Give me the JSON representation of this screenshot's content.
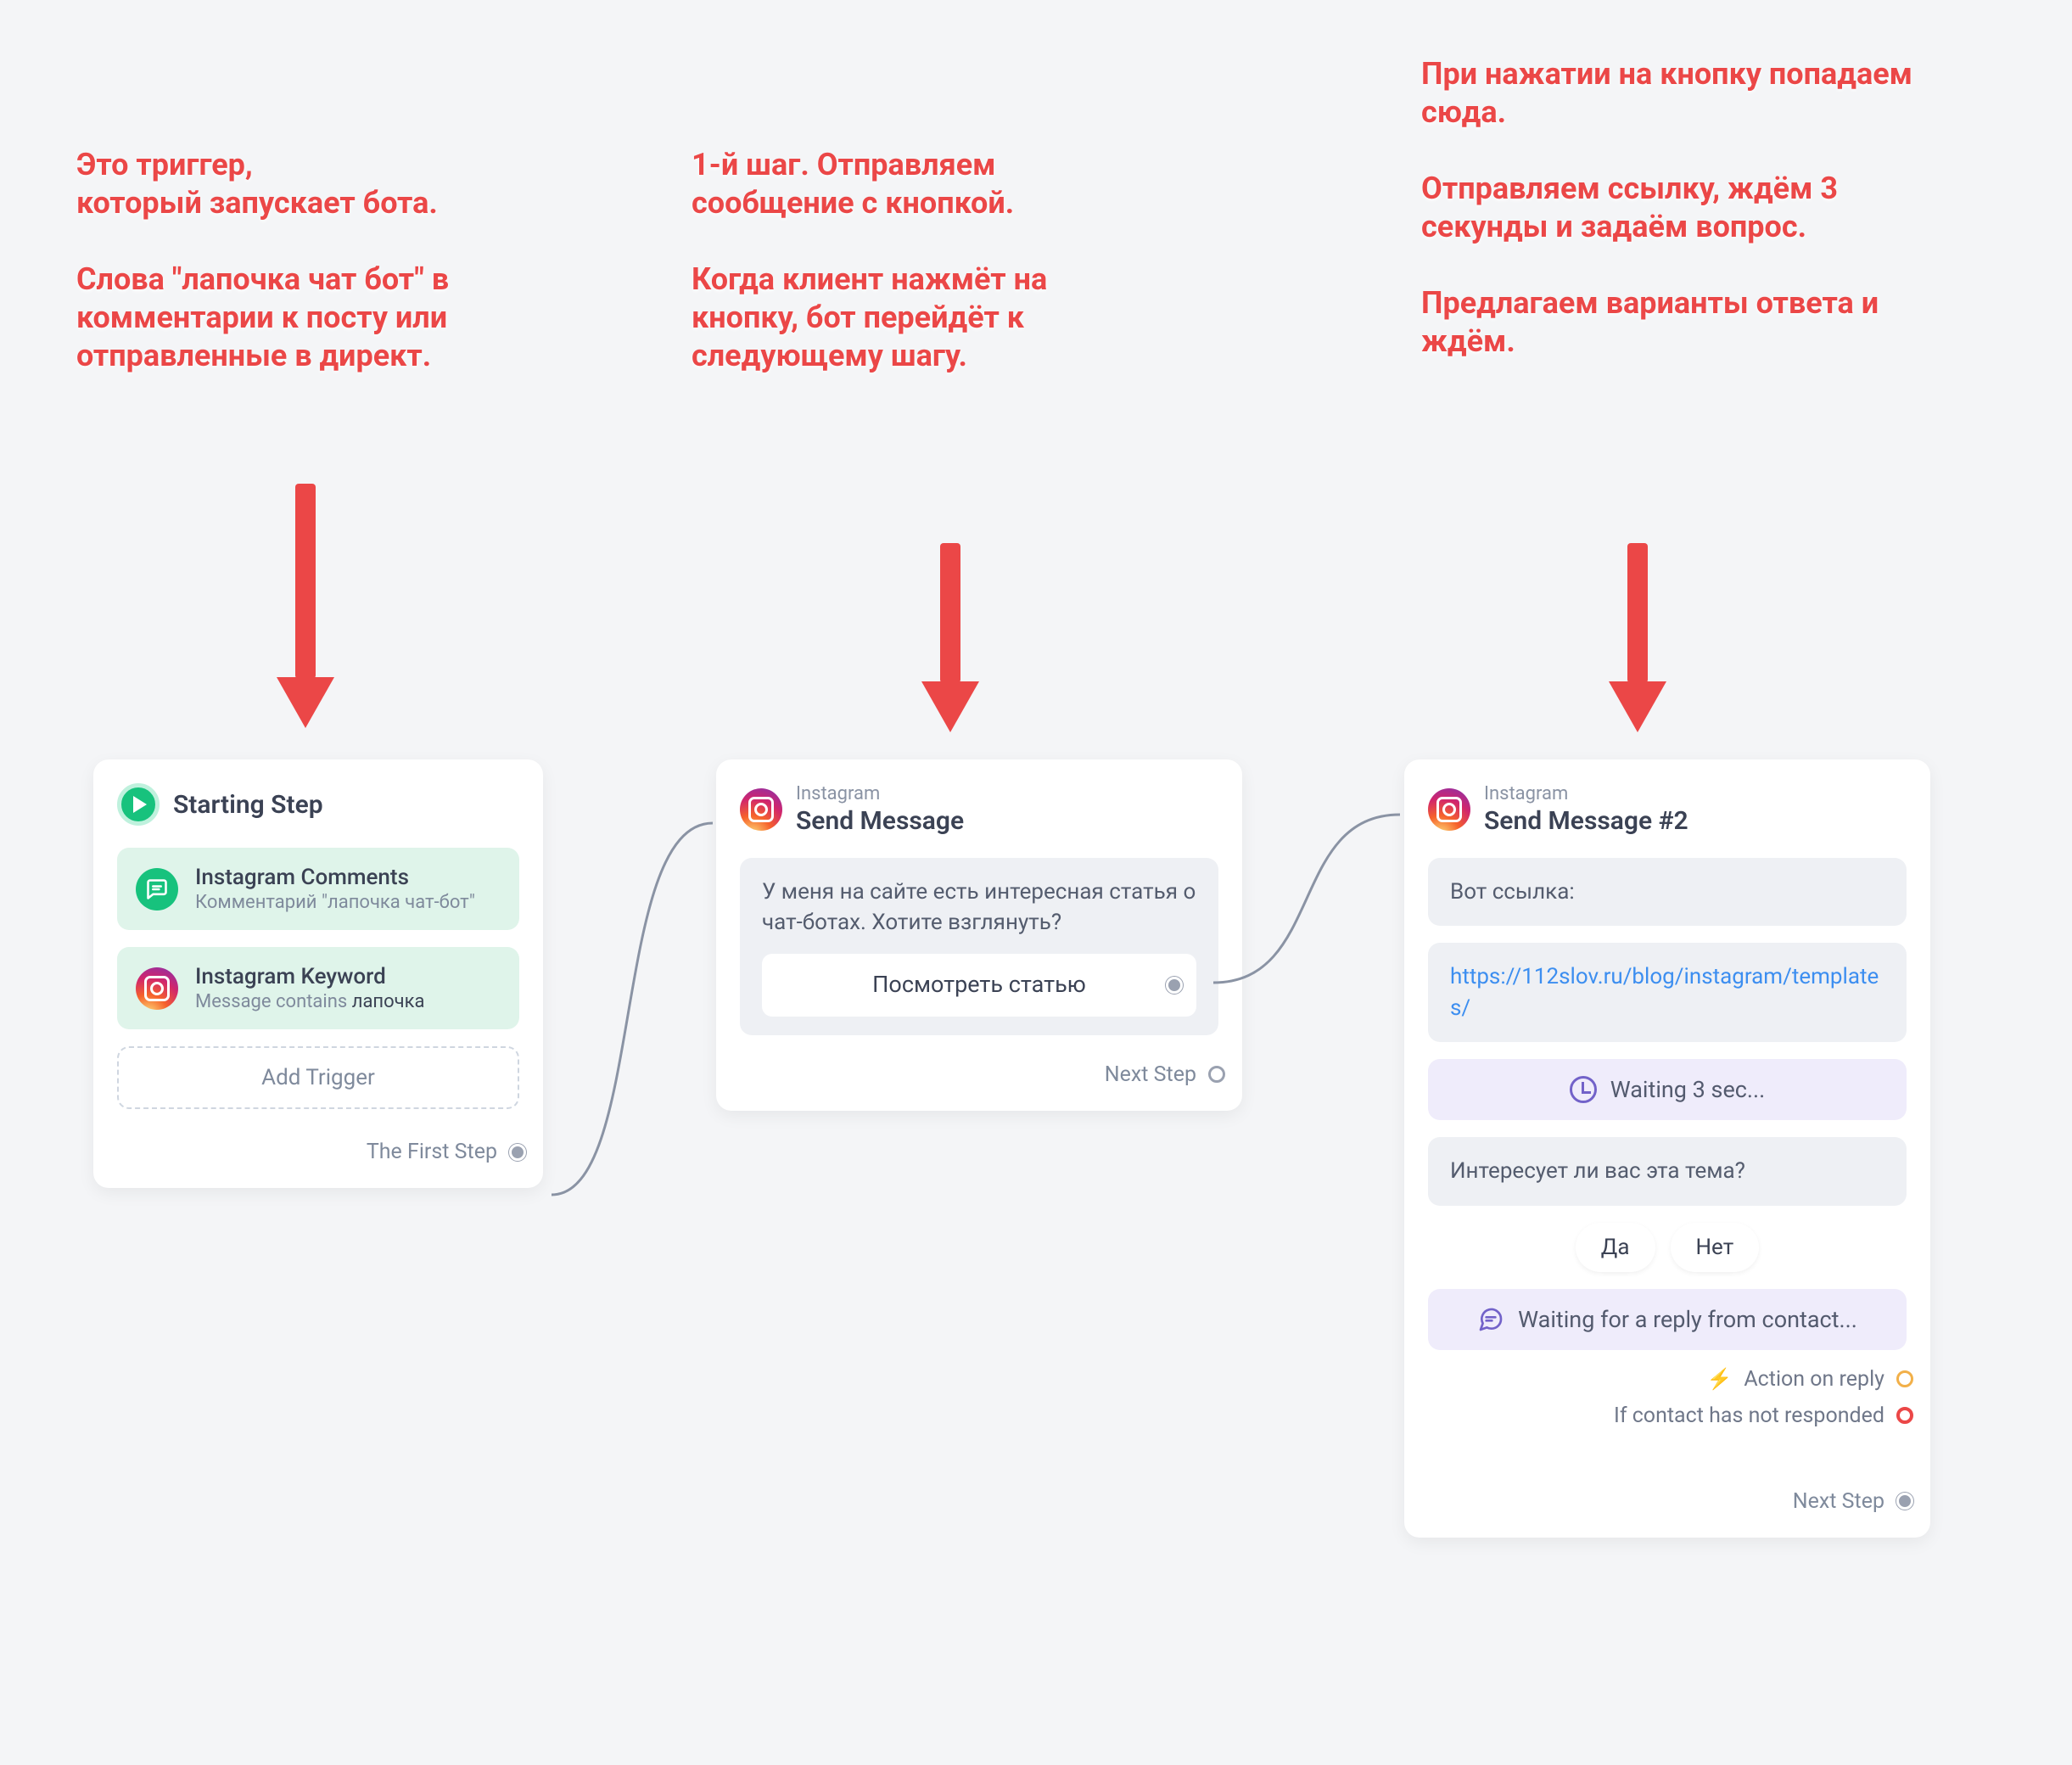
{
  "annotations": {
    "a1": "Это триггер,\nкоторый запускает бота.\n\nСлова \"лапочка чат бот\" в комментарии к посту или отправленные в директ.",
    "a2": "1-й шаг. Отправляем сообщение с кнопкой.\n\nКогда клиент нажмёт на кнопку, бот перейдёт к следующему шагу.",
    "a3": "При нажатии на кнопку попадаем сюда.\n\nОтправляем ссылку, ждём 3 секунды и задаём вопрос.\n\nПредлагаем варианты ответа и ждём."
  },
  "card1": {
    "title": "Starting Step",
    "trigger1": {
      "title": "Instagram Comments",
      "subtitle": "Комментарий \"лапочка чат-бот\""
    },
    "trigger2": {
      "title": "Instagram Keyword",
      "subtitle_prefix": "Message contains ",
      "subtitle_keyword": "лапочка"
    },
    "add_trigger": "Add Trigger",
    "footer": "The First Step"
  },
  "card2": {
    "pretitle": "Instagram",
    "title": "Send Message",
    "message": "У меня на сайте есть интересная статья о чат-ботах. Хотите взглянуть?",
    "button": "Посмотреть статью",
    "footer": "Next Step"
  },
  "card3": {
    "pretitle": "Instagram",
    "title": "Send Message #2",
    "msg1": "Вот ссылка:",
    "link": "https://112slov.ru/blog/instagram/templates/",
    "wait": "Waiting 3 sec...",
    "msg2": "Интересует ли вас эта тема?",
    "chip_yes": "Да",
    "chip_no": "Нет",
    "wait_reply": "Waiting for a reply from contact...",
    "action_reply": "Action on reply",
    "action_noresp": "If contact has not responded",
    "footer": "Next Step"
  }
}
